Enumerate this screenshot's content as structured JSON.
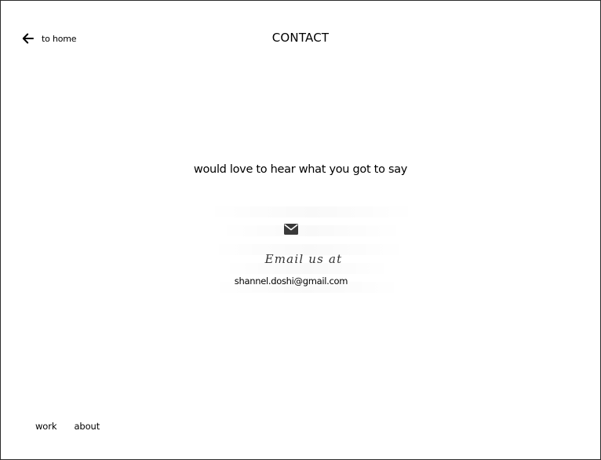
{
  "header": {
    "back_label": "to home",
    "title": "CONTACT"
  },
  "main": {
    "tagline": "would love to hear what you got to say",
    "contact": {
      "icon": "envelope-icon",
      "heading": "Email us at",
      "email": "shannel.doshi@gmail.com"
    }
  },
  "footer": {
    "nav": [
      {
        "label": "work"
      },
      {
        "label": "about"
      }
    ]
  }
}
